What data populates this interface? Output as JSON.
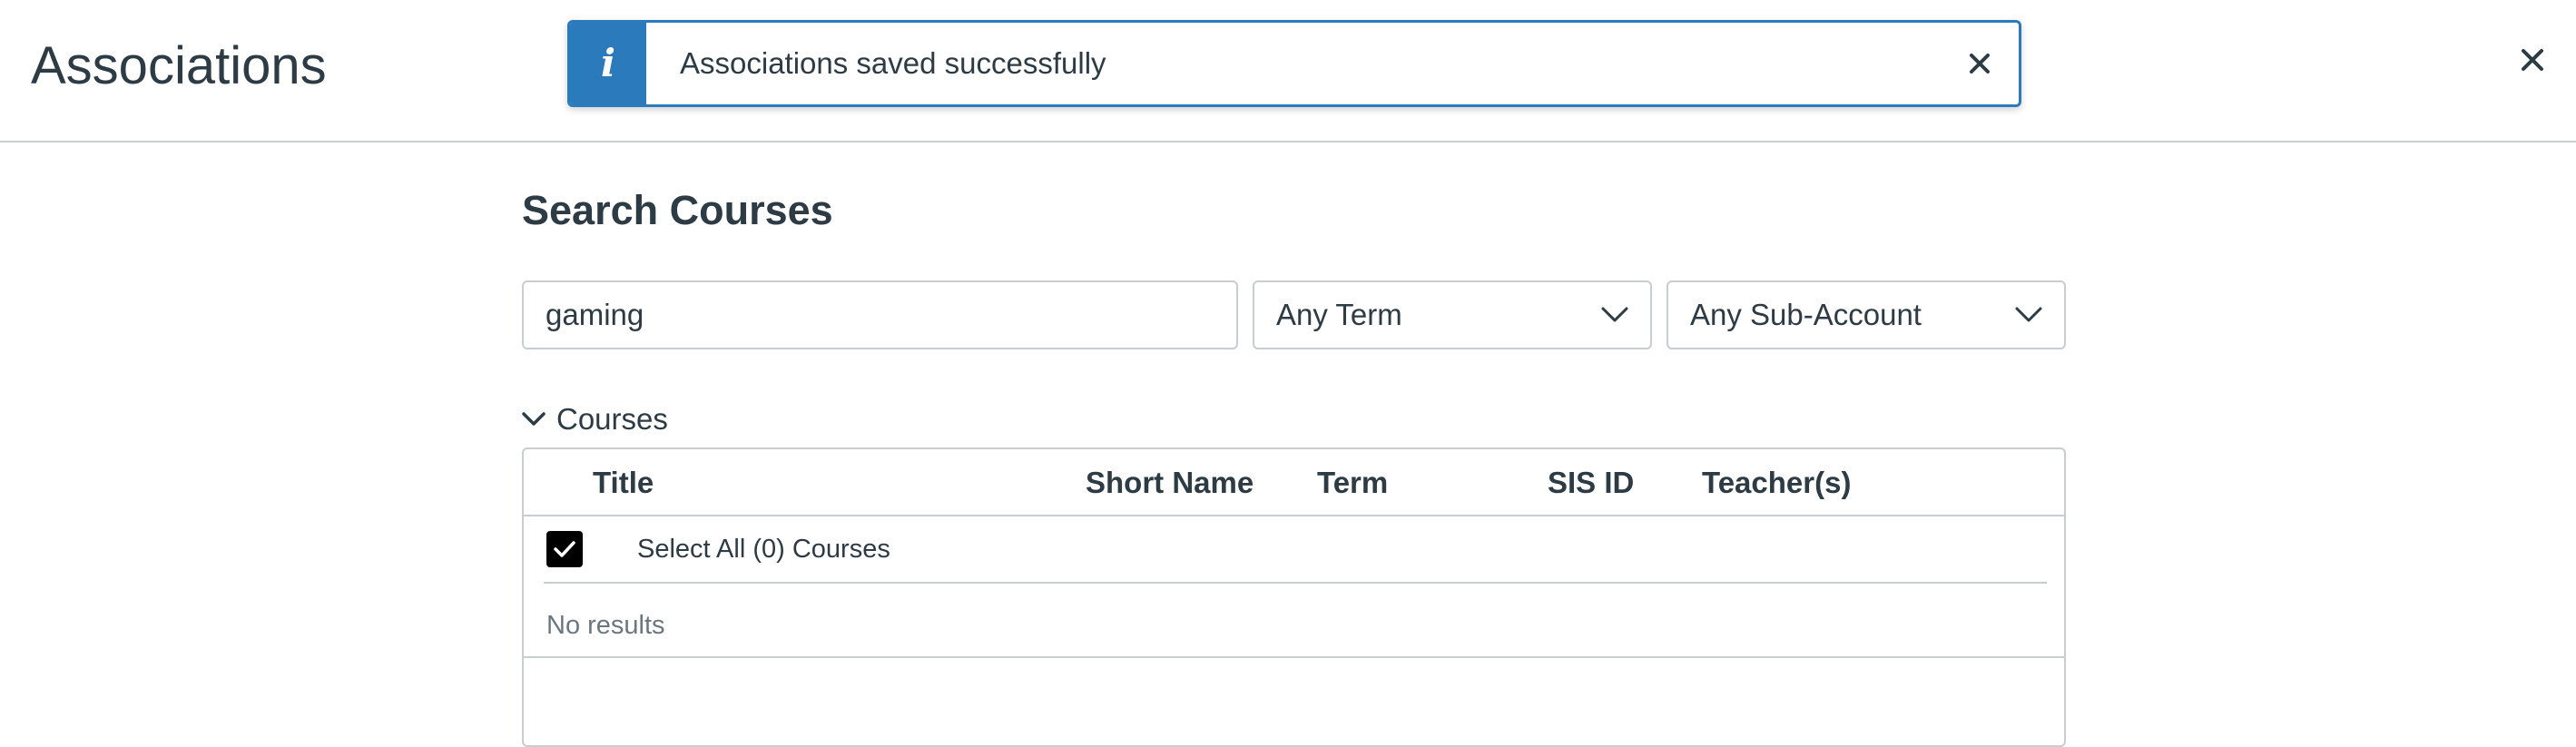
{
  "header": {
    "title": "Associations",
    "close_icon": "close-icon"
  },
  "alert": {
    "icon": "info-icon",
    "message": "Associations saved successfully",
    "close_icon": "close-icon",
    "color": "#2b7abc"
  },
  "search": {
    "heading": "Search Courses",
    "query_value": "gaming",
    "term_select": {
      "selected": "Any Term",
      "icon": "chevron-down-icon"
    },
    "subaccount_select": {
      "selected": "Any Sub-Account",
      "icon": "chevron-down-icon"
    }
  },
  "courses": {
    "toggle_label": "Courses",
    "toggle_icon": "chevron-down-icon",
    "columns": [
      "Title",
      "Short Name",
      "Term",
      "SIS ID",
      "Teacher(s)"
    ],
    "select_all_label": "Select All (0) Courses",
    "select_all_checked": true,
    "empty_text": "No results"
  },
  "colors": {
    "text": "#2d3b45",
    "border": "#c7cdd1",
    "muted": "#6b7780",
    "checkbox": "#000000"
  }
}
